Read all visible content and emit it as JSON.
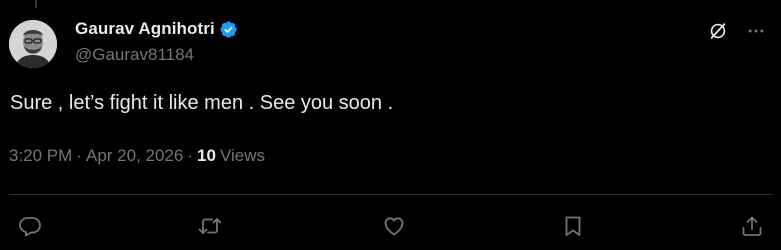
{
  "author": {
    "display_name": "Gaurav Agnihotri",
    "handle": "@Gaurav81184",
    "verified": true
  },
  "tweet": {
    "text": "Sure , let’s fight it like men . See you soon ."
  },
  "meta": {
    "time": "3:20 PM",
    "separator1": "·",
    "date": "Apr 20, 2026",
    "separator2": "·",
    "views_count": "10",
    "views_label": "Views"
  },
  "icons": {
    "grok": "grok-icon",
    "more": "more-icon",
    "reply": "reply-icon",
    "retweet": "retweet-icon",
    "like": "like-icon",
    "bookmark": "bookmark-icon",
    "share": "share-icon"
  },
  "colors": {
    "background": "#000000",
    "text_primary": "#e7e9ea",
    "text_secondary": "#71767b",
    "verified": "#1d9bf0",
    "divider": "#2f3336"
  }
}
